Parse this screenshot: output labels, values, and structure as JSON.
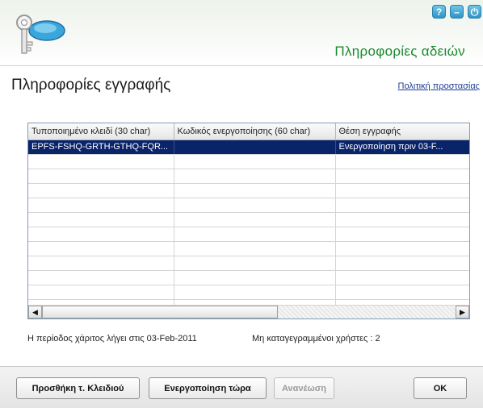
{
  "header": {
    "title": "Πληροφορίες αδειών",
    "controls": [
      {
        "name": "help-icon",
        "glyph": "?"
      },
      {
        "name": "minimize-icon",
        "glyph": "–"
      },
      {
        "name": "power-icon",
        "glyph": "⏻"
      }
    ],
    "colors": {
      "title": "#1a8a2e",
      "control": "#2f93c6"
    }
  },
  "page": {
    "title": "Πληροφορίες εγγραφής",
    "privacy_link": "Πολιτική προστασίας"
  },
  "table": {
    "columns": [
      "Τυποποιημένο κλειδί (30 char)",
      "Κωδικός ενεργοποίησης (60 char)",
      "Θέση εγγραφής"
    ],
    "rows": [
      [
        "EPFS-FSHQ-GRTH-GTHQ-FQR...",
        "",
        "Ενεργοποίηση πριν  03-F..."
      ]
    ],
    "empty_rows": 11,
    "selection_color": "#0a246a"
  },
  "status": {
    "grace_period": "Η περίοδος χάριτος λήγει στις 03-Feb-2011",
    "unregistered_users": "Μη καταγεγραμμένοι χρήστες : 2"
  },
  "buttons": {
    "add_key": "Προσθήκη τ. Κλειδιού",
    "activate_now": "Ενεργοποίηση τώρα",
    "refresh": "Ανανέωση",
    "ok": "OK"
  }
}
